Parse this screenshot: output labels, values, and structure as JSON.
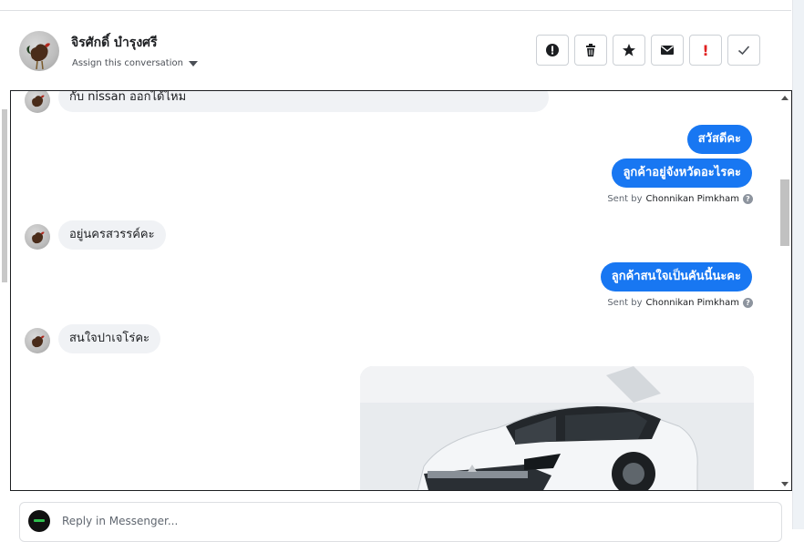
{
  "header": {
    "contact_name": "จิรศักดิ์ บำรุงศรี",
    "assign_label": "Assign this conversation",
    "actions": [
      {
        "name": "mark-spam-button",
        "icon": "alert-circle-icon"
      },
      {
        "name": "delete-button",
        "icon": "trash-icon"
      },
      {
        "name": "star-button",
        "icon": "star-icon"
      },
      {
        "name": "mark-unread-button",
        "icon": "envelope-icon"
      },
      {
        "name": "follow-up-button",
        "icon": "exclamation-icon",
        "glyph": "!"
      },
      {
        "name": "mark-done-button",
        "icon": "check-icon"
      }
    ]
  },
  "messages": {
    "m1": "กับ nissan ออกได้ไหม",
    "m2": "สวัสดีคะ",
    "m3": "ลูกค้าอยู่จังหวัดอะไรคะ",
    "sent1_prefix": "Sent by",
    "sent1_name": "Chonnikan Pimkham",
    "m4": "อยู่นครสวรรค์คะ",
    "m5": "ลูกค้าสนใจเป็นคันนี้นะคะ",
    "sent2_prefix": "Sent by",
    "sent2_name": "Chonnikan Pimkham",
    "m6": "สนใจปาเจโร่คะ"
  },
  "reply": {
    "placeholder": "Reply in Messenger..."
  },
  "colors": {
    "outgoing_bubble": "#1877f2",
    "incoming_bubble": "#f0f2f5"
  }
}
